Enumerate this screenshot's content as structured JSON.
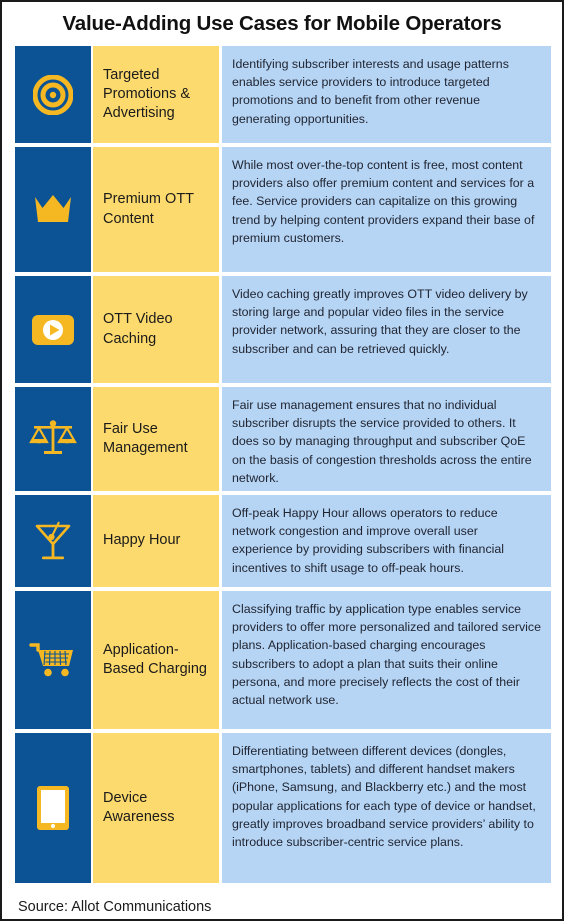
{
  "title": "Value-Adding Use Cases for Mobile Operators",
  "colors": {
    "icon_cell_bg": "#0b5394",
    "label_cell_bg": "#fdda6d",
    "desc_cell_bg": "#b6d4f4",
    "icon_accent": "#f6b822",
    "page_bg": "#ffffff",
    "border": "#1a1a1a",
    "text": "#1b1b1b"
  },
  "rows": [
    {
      "icon": "target-icon",
      "label": "Targeted Promotions & Advertising",
      "description": "Identifying subscriber interests and usage patterns enables service providers to introduce targeted promotions and to benefit from other revenue generating opportunities."
    },
    {
      "icon": "crown-icon",
      "label": "Premium OTT Content",
      "description": "While most over-the-top content is free, most content providers also offer premium content and services for a fee. Service providers can capitalize on this growing trend by helping content providers expand their base of premium customers."
    },
    {
      "icon": "play-button-icon",
      "label": "OTT Video Caching",
      "description": "Video caching greatly improves OTT video delivery by storing large and popular video files in the service provider network, assuring that they are closer to the subscriber and can be retrieved quickly."
    },
    {
      "icon": "balance-scales-icon",
      "label": "Fair Use Management",
      "description": "Fair use management ensures that no individual subscriber disrupts the service provided to others. It does so by managing throughput and subscriber QoE on the basis of congestion thresholds across the entire network."
    },
    {
      "icon": "cocktail-glass-icon",
      "label": "Happy Hour",
      "description": "Off-peak Happy Hour allows operators to reduce network congestion and improve overall user experience by providing subscribers with financial incentives to shift usage to off-peak hours."
    },
    {
      "icon": "shopping-cart-icon",
      "label": "Application-Based Charging",
      "description": "Classifying traffic by application type enables service providers to offer more personalized and tailored service plans. Application-based charging encourages subscribers to adopt a plan that suits their online persona, and more precisely reflects the cost of their actual network use."
    },
    {
      "icon": "tablet-device-icon",
      "label": "Device Awareness",
      "description": "Differentiating between different devices (dongles, smartphones, tablets) and different handset makers (iPhone, Samsung, and Blackberry etc.) and the most popular applications for each type of device or handset, greatly improves broadband service providers’ ability to introduce subscriber-centric service plans."
    }
  ],
  "footer": "Source: Allot Communications"
}
